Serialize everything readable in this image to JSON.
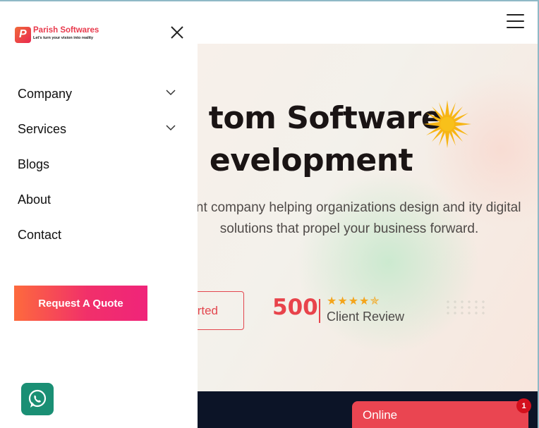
{
  "brand": {
    "name": "Parish Softwares",
    "tagline": "Let's turn your vision into reality",
    "logo_letter": "P",
    "accent": "#e8394c"
  },
  "drawer": {
    "menu": [
      {
        "label": "Company",
        "has_submenu": true
      },
      {
        "label": "Services",
        "has_submenu": true
      },
      {
        "label": "Blogs",
        "has_submenu": false
      },
      {
        "label": "About",
        "has_submenu": false
      },
      {
        "label": "Contact",
        "has_submenu": false
      }
    ],
    "quote_button": "Request A Quote"
  },
  "hero": {
    "title_line1": "tom Software",
    "title_line2": "evelopment",
    "description": "ment company helping organizations design and ity digital solutions that propel your business forward.",
    "cta_label": "rted",
    "review_count": "500",
    "review_label": "Client Review",
    "stars": "★★★★✯",
    "rating": 4.5
  },
  "chat": {
    "label": "Online",
    "badge": "1",
    "color": "#ea4551"
  },
  "icons": {
    "close": "close-icon",
    "menu": "hamburger-icon",
    "whatsapp": "whatsapp-icon",
    "chevron": "chevron-down-icon"
  }
}
